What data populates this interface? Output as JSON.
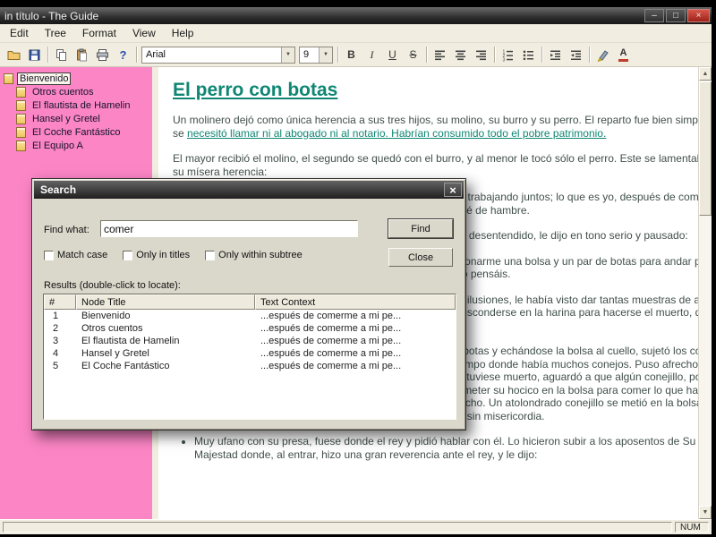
{
  "window": {
    "title": "in título - The Guide"
  },
  "menu": {
    "items": [
      "Edit",
      "Tree",
      "Format",
      "View",
      "Help"
    ]
  },
  "toolbar": {
    "font_name": "Arial",
    "font_size": "9",
    "buttons": {
      "bold": "B",
      "italic": "I",
      "underline": "U",
      "strike": "S"
    },
    "icons": [
      "open-icon",
      "save-icon",
      "copy-icon",
      "paste-icon",
      "print-icon",
      "help-icon",
      "align-left-icon",
      "align-center-icon",
      "align-right-icon",
      "numbered-list-icon",
      "bullet-list-icon",
      "outdent-icon",
      "indent-icon",
      "highlight-icon",
      "font-color-icon"
    ]
  },
  "tree": {
    "items": [
      {
        "label": "Bienvenido"
      },
      {
        "label": "Otros cuentos"
      },
      {
        "label": "El flautista de Hamelin"
      },
      {
        "label": "Hansel y Gretel"
      },
      {
        "label": "El Coche Fantástico"
      },
      {
        "label": "El Equipo A"
      }
    ]
  },
  "document": {
    "title": "El perro con botas",
    "p1_pre": "Un molinero dejó como única herencia a sus tres hijos, su molino, su burro y su perro. El reparto fue bien simple: no se ",
    "p1_link": "necesitó llamar ni al abogado ni al notario. Habrían consumido todo el pobre patrimonio.",
    "p2": "El mayor recibió el molino, el segundo se quedó con el burro, y al menor le tocó sólo el perro. Este se lamentaba de su mísera herencia:",
    "bullets": [
      "Mis hermanos podrán ganarse la vida convenientemente trabajando juntos; lo que es yo, después de comerme a mi perro y de hacerme un manguito con su piel, me moriré de hambre.",
      "El perro, que escuchaba estas palabras, pero se hacía el desentendido, le dijo en tono serio y pausado:",
      "No debéis afligiros, mi señor, no tenéis más que proporcionarme una bolsa y un par de botas para andar por entre los matorrales, y veréis que no sois tan pobre como pensáis.",
      "Aunque el amo del perro no abrigara sobre esto grandes ilusiones, le había visto dar tantas muestras de agilidad para cazar ratas y ratones, como colgarse de los pies o esconderse en la harina para hacerse el muerto, que no desesperó de verse socorrido por él en su miseria.",
      "Cuando el perro tuvo lo que había pedido, se colocó las botas y echándose la bolsa al cuello, sujetó los cordones de ésta con las dos patas delanteras, y se dirigió a un campo donde había muchos conejos. Puso afrecho y hierbas en su bolsa y tendiéndose en el suelo como si estuviese muerto, aguardó a que algún conejillo, poco conocedor aún de las astucias de este mundo, viniera a meter su hocico en la bolsa para comer lo que había dentro. No bien se hubo recostado, cuando se vio satisfecho. Un atolondrado conejillo se metió en la bolsa y el maestro perro, tirando los cordones, lo encerró y lo mató sin misericordia.",
      "Muy ufano con su presa, fuese donde el rey y pidió hablar con él. Lo hicieron subir a los aposentos de Su Majestad donde, al entrar, hizo una gran reverencia ante el rey, y le dijo:"
    ]
  },
  "search_dialog": {
    "title": "Search",
    "find_label": "Find what:",
    "find_value": "comer",
    "find_button": "Find",
    "close_button": "Close",
    "checkboxes": [
      "Match case",
      "Only in titles",
      "Only within subtree"
    ],
    "results_label": "Results (double-click to locate):",
    "results": {
      "headers": [
        "#",
        "Node Title",
        "Text Context"
      ],
      "rows": [
        [
          "1",
          "Bienvenido",
          "...espués de comerme a mi pe..."
        ],
        [
          "2",
          "Otros cuentos",
          "...espués de comerme a mi pe..."
        ],
        [
          "3",
          "El flautista de Hamelin",
          "...espués de comerme a mi pe..."
        ],
        [
          "4",
          "Hansel y Gretel",
          "...espués de comerme a mi pe..."
        ],
        [
          "5",
          "El Coche Fantástico",
          "...espués de comerme a mi pe..."
        ]
      ]
    }
  },
  "statusbar": {
    "num": "NUM"
  },
  "colors": {
    "tree_bg": "#fb85c5",
    "accent_teal": "#0f8673",
    "close_red": "#c23b2e"
  }
}
